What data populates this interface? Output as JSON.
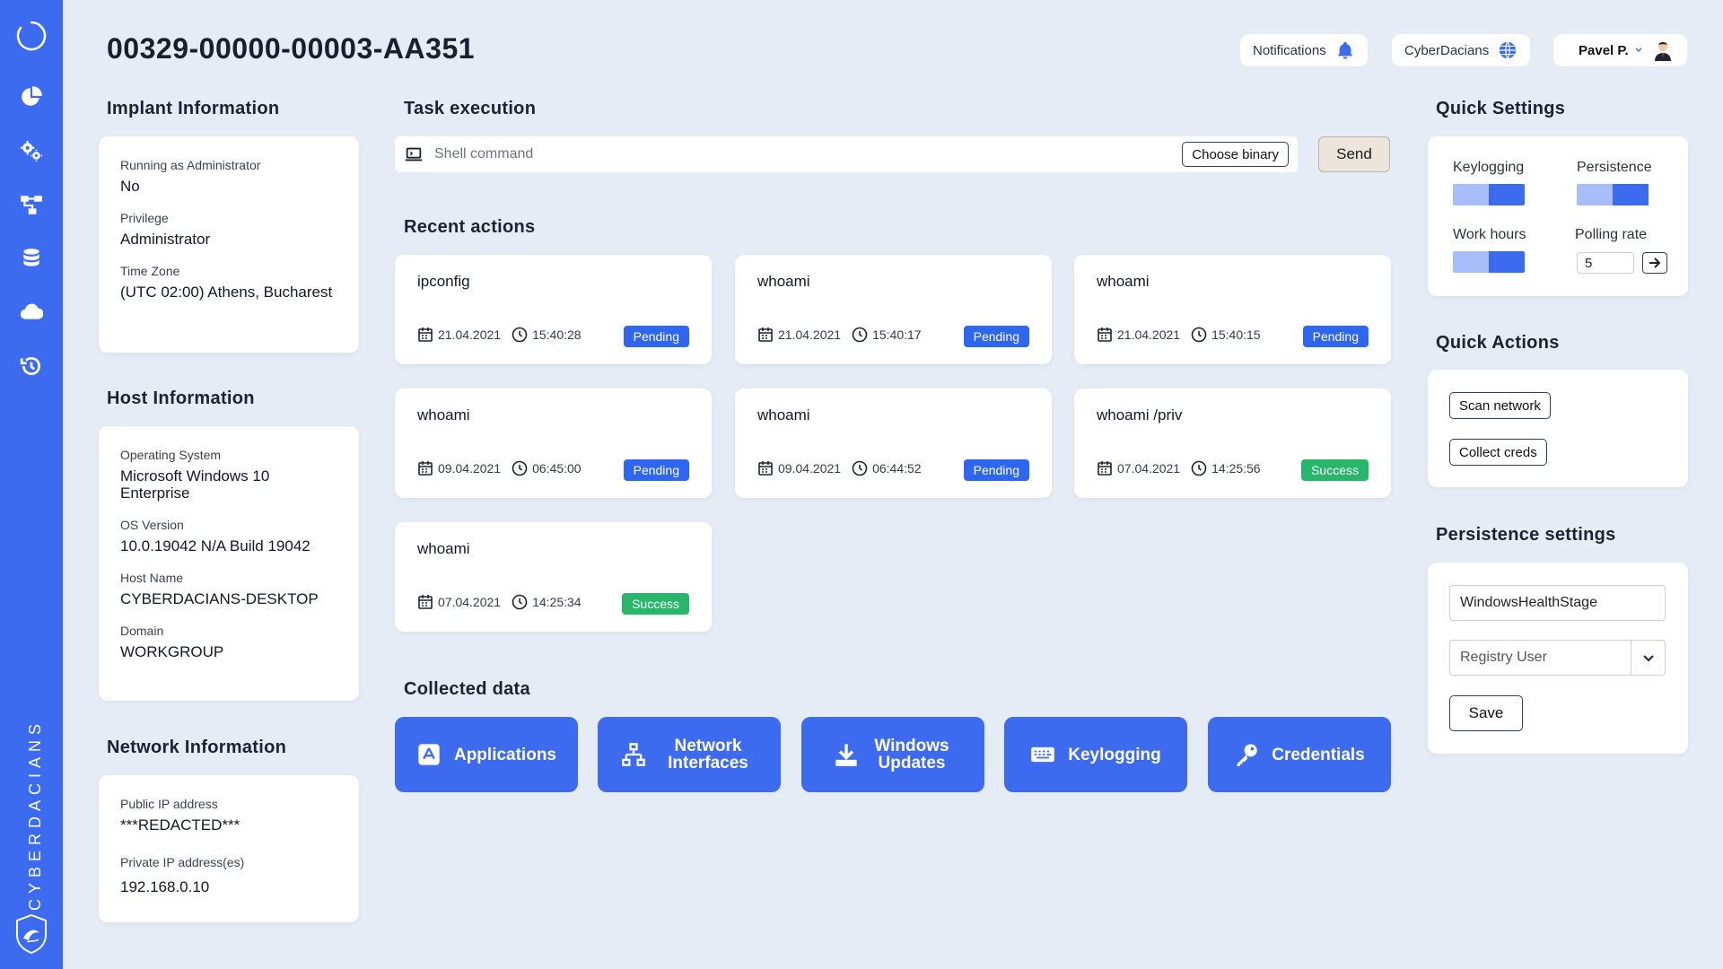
{
  "header": {
    "title": "00329-00000-00003-AA351",
    "notifications_label": "Notifications",
    "org_label": "CyberDacians",
    "user_label": "Pavel P."
  },
  "sidebar": {
    "brand_text": "CYBERDACIANS",
    "items": [
      {
        "icon": "loader-ring-icon"
      },
      {
        "icon": "pie-chart-icon"
      },
      {
        "icon": "gears-icon"
      },
      {
        "icon": "network-tree-icon"
      },
      {
        "icon": "database-icon"
      },
      {
        "icon": "cloud-icon"
      },
      {
        "icon": "history-icon"
      }
    ]
  },
  "implant": {
    "section_title": "Implant Information",
    "items": [
      {
        "label": "Running as Administrator",
        "value": "No"
      },
      {
        "label": "Privilege",
        "value": "Administrator"
      },
      {
        "label": "Time Zone",
        "value": "(UTC 02:00) Athens, Bucharest"
      }
    ]
  },
  "host": {
    "section_title": "Host Information",
    "items": [
      {
        "label": "Operating System",
        "value": "Microsoft Windows 10 Enterprise"
      },
      {
        "label": "OS Version",
        "value": "10.0.19042 N/A Build 19042"
      },
      {
        "label": "Host Name",
        "value": "CYBERDACIANS-DESKTOP"
      },
      {
        "label": "Domain",
        "value": "WORKGROUP"
      }
    ]
  },
  "network": {
    "section_title": "Network Information",
    "items": [
      {
        "label": "Public IP address",
        "value": "***REDACTED***"
      },
      {
        "label": "Private IP address(es)",
        "value": "192.168.0.10"
      }
    ]
  },
  "task": {
    "section_title": "Task execution",
    "input_placeholder": "Shell command",
    "choose_binary_label": "Choose binary",
    "send_label": "Send"
  },
  "recent": {
    "section_title": "Recent actions",
    "actions": [
      {
        "command": "ipconfig",
        "date": "21.04.2021",
        "time": "15:40:28",
        "status": "Pending"
      },
      {
        "command": "whoami",
        "date": "21.04.2021",
        "time": "15:40:17",
        "status": "Pending"
      },
      {
        "command": "whoami",
        "date": "21.04.2021",
        "time": "15:40:15",
        "status": "Pending"
      },
      {
        "command": "whoami",
        "date": "09.04.2021",
        "time": "06:45:00",
        "status": "Pending"
      },
      {
        "command": "whoami",
        "date": "09.04.2021",
        "time": "06:44:52",
        "status": "Pending"
      },
      {
        "command": "whoami /priv",
        "date": "07.04.2021",
        "time": "14:25:56",
        "status": "Success"
      },
      {
        "command": "whoami",
        "date": "07.04.2021",
        "time": "14:25:34",
        "status": "Success"
      }
    ]
  },
  "collected": {
    "section_title": "Collected data",
    "buttons": [
      {
        "label": "Applications",
        "icon": "app-store-icon"
      },
      {
        "label": "Network Interfaces",
        "icon": "network-icon"
      },
      {
        "label": "Windows Updates",
        "icon": "download-icon"
      },
      {
        "label": "Keylogging",
        "icon": "keyboard-icon"
      },
      {
        "label": "Credentials",
        "icon": "key-icon"
      }
    ]
  },
  "quick_settings": {
    "section_title": "Quick Settings",
    "keylogging_label": "Keylogging",
    "persistence_label": "Persistence",
    "work_hours_label": "Work hours",
    "polling_rate_label": "Polling rate",
    "polling_rate_value": "5"
  },
  "quick_actions": {
    "section_title": "Quick Actions",
    "scan_network_label": "Scan network",
    "collect_creds_label": "Collect creds"
  },
  "persistence_settings": {
    "section_title": "Persistence settings",
    "name_value": "WindowsHealthStage",
    "method_value": "Registry User",
    "save_label": "Save"
  },
  "colors": {
    "accent": "#3d6bf0",
    "pending": "#2f66ef",
    "success": "#27b66a",
    "background": "#e6ecf5"
  }
}
